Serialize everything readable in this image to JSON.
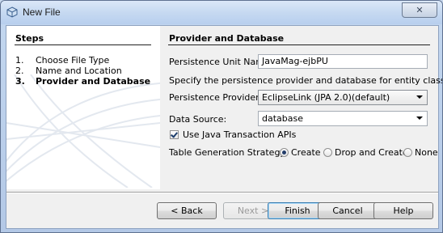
{
  "window": {
    "title": "New File",
    "close_glyph": "✕"
  },
  "steps": {
    "heading": "Steps",
    "items": [
      {
        "num": "1.",
        "label": "Choose File Type",
        "current": false
      },
      {
        "num": "2.",
        "label": "Name and Location",
        "current": false
      },
      {
        "num": "3.",
        "label": "Provider and Database",
        "current": true
      }
    ]
  },
  "form": {
    "heading": "Provider and Database",
    "unit_name": {
      "label": "Persistence Unit Name:",
      "value": "JavaMag-ejbPU"
    },
    "description": "Specify the persistence provider and database for entity classes.",
    "provider": {
      "label": "Persistence Provider:",
      "value": "EclipseLink (JPA 2.0)(default)"
    },
    "data_source": {
      "label": "Data Source:",
      "value": "database"
    },
    "jta": {
      "label": "Use Java Transaction APIs",
      "checked": true
    },
    "table_strategy": {
      "label": "Table Generation Strategy:",
      "options": [
        {
          "label": "Create",
          "selected": true
        },
        {
          "label": "Drop and Create",
          "selected": false
        },
        {
          "label": "None",
          "selected": false
        }
      ]
    }
  },
  "buttons": {
    "back": "< Back",
    "next": "Next >",
    "finish": "Finish",
    "cancel": "Cancel",
    "help": "Help"
  },
  "colors": {
    "accent": "#3c7fb1",
    "title_bar": "#c6d9f1"
  }
}
